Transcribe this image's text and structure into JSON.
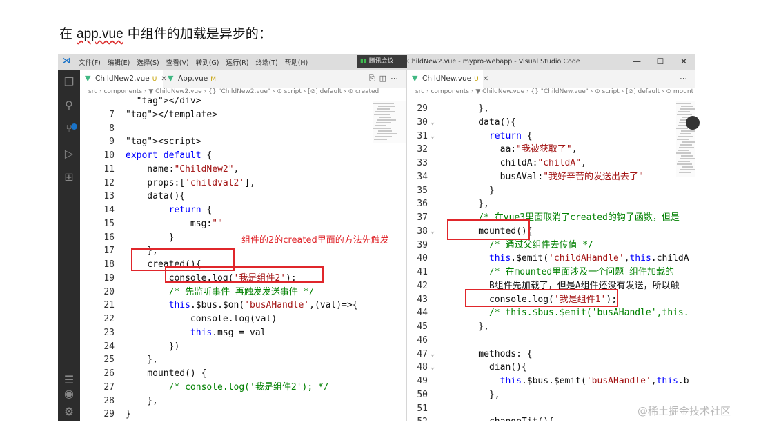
{
  "doc": {
    "title_prefix": "在 ",
    "title_app": "app.vue",
    "title_suffix": " 中组件的加载是异步的："
  },
  "window": {
    "menu": [
      "文件(F)",
      "编辑(E)",
      "选择(S)",
      "查看(V)",
      "转到(G)",
      "运行(R)",
      "终端(T)",
      "帮助(H)"
    ],
    "meeting": "腾讯会议",
    "title": "ChildNew2.vue - mypro-webapp - Visual Studio Code",
    "controls": [
      "—",
      "☐",
      "✕"
    ]
  },
  "left": {
    "tabs": [
      {
        "name": "ChildNew2.vue",
        "status": "U"
      },
      {
        "name": "App.vue",
        "status": "M"
      }
    ],
    "breadcrumb": "src › components › ▼ ChildNew2.vue › {} \"ChildNew2.vue\" › ⊙ script › [⊘] default › ⊙ created",
    "lines": [
      {
        "n": "",
        "text": "  </div>"
      },
      {
        "n": "7",
        "text": "</template>"
      },
      {
        "n": "8",
        "text": ""
      },
      {
        "n": "9",
        "text": "<script>"
      },
      {
        "n": "10",
        "text": "export default {"
      },
      {
        "n": "11",
        "text": "    name:\"ChildNew2\","
      },
      {
        "n": "12",
        "text": "    props:['childval2'],"
      },
      {
        "n": "13",
        "text": "    data(){"
      },
      {
        "n": "14",
        "text": "        return {"
      },
      {
        "n": "15",
        "text": "            msg:\"\""
      },
      {
        "n": "16",
        "text": "        }"
      },
      {
        "n": "17",
        "text": "    },"
      },
      {
        "n": "18",
        "text": "    created(){"
      },
      {
        "n": "19",
        "text": "        console.log('我是组件2');"
      },
      {
        "n": "20",
        "text": "        /* 先监听事件 再触发发送事件 */"
      },
      {
        "n": "21",
        "text": "        this.$bus.$on('busAHandle',(val)=>{"
      },
      {
        "n": "22",
        "text": "            console.log(val)"
      },
      {
        "n": "23",
        "text": "            this.msg = val"
      },
      {
        "n": "24",
        "text": "        })"
      },
      {
        "n": "25",
        "text": "    },"
      },
      {
        "n": "26",
        "text": "    mounted() {"
      },
      {
        "n": "27",
        "text": "        /* console.log('我是组件2'); */"
      },
      {
        "n": "28",
        "text": "    },"
      },
      {
        "n": "29",
        "text": "}"
      }
    ],
    "annotation": "组件的2的created里面的方法先触发"
  },
  "right": {
    "tabs": [
      {
        "name": "ChildNew.vue",
        "status": "U"
      }
    ],
    "breadcrumb": "src › components › ▼ ChildNew.vue › {} \"ChildNew.vue\" › ⊙ script › [⊘] default › ⊙ mount",
    "lines": [
      {
        "n": "29",
        "fold": "",
        "text": "    },"
      },
      {
        "n": "30",
        "fold": "⌄",
        "text": "    data(){"
      },
      {
        "n": "31",
        "fold": "⌄",
        "text": "      return {"
      },
      {
        "n": "32",
        "fold": "",
        "text": "        aa:\"我被获取了\","
      },
      {
        "n": "33",
        "fold": "",
        "text": "        childA:\"childA\","
      },
      {
        "n": "34",
        "fold": "",
        "text": "        busAVal:\"我好辛苦的发送出去了\""
      },
      {
        "n": "35",
        "fold": "",
        "text": "      }"
      },
      {
        "n": "36",
        "fold": "",
        "text": "    },"
      },
      {
        "n": "37",
        "fold": "",
        "text": "    /* 在vue3里面取消了created的钩子函数，但是"
      },
      {
        "n": "38",
        "fold": "⌄",
        "text": "    mounted(){"
      },
      {
        "n": "39",
        "fold": "",
        "text": "      /* 通过父组件去传值 */"
      },
      {
        "n": "40",
        "fold": "",
        "text": "      this.$emit('childAHandle',this.childA"
      },
      {
        "n": "41",
        "fold": "",
        "text": "      /* 在mounted里面涉及一个问题 组件加载的"
      },
      {
        "n": "42",
        "fold": "",
        "text": "      B组件先加载了，但是A组件还没有发送，所以触"
      },
      {
        "n": "43",
        "fold": "",
        "text": "      console.log('我是组件1');"
      },
      {
        "n": "44",
        "fold": "",
        "text": "      /* this.$bus.$emit('busAHandle',this."
      },
      {
        "n": "45",
        "fold": "",
        "text": "    },"
      },
      {
        "n": "46",
        "fold": "",
        "text": ""
      },
      {
        "n": "47",
        "fold": "⌄",
        "text": "    methods: {"
      },
      {
        "n": "48",
        "fold": "⌄",
        "text": "      dian(){"
      },
      {
        "n": "49",
        "fold": "",
        "text": "        this.$bus.$emit('busAHandle',this.b"
      },
      {
        "n": "50",
        "fold": "",
        "text": "      },"
      },
      {
        "n": "51",
        "fold": "",
        "text": ""
      },
      {
        "n": "52",
        "fold": "⌄",
        "text": "      changeTit(){"
      }
    ]
  },
  "watermark": "@稀土掘金技术社区"
}
